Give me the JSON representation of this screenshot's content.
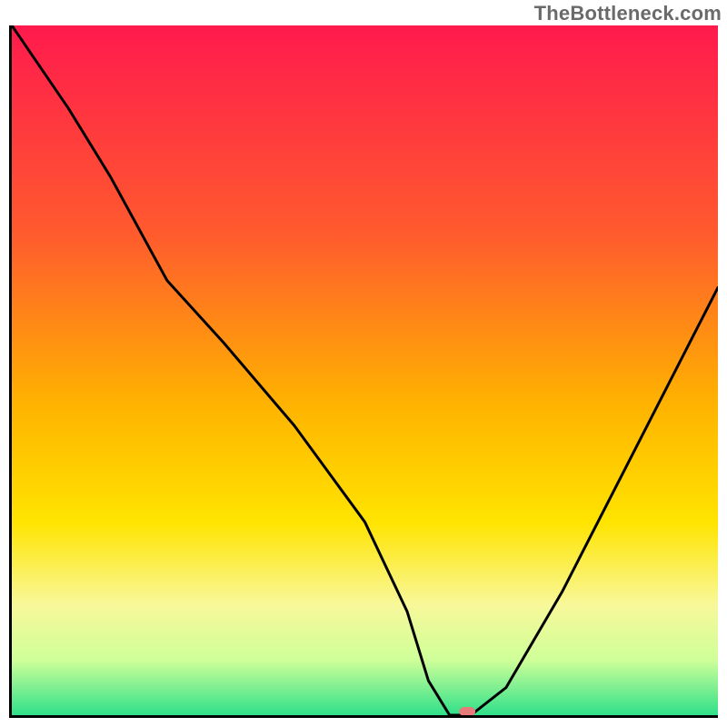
{
  "watermark": "TheBottleneck.com",
  "chart_data": {
    "type": "line",
    "title": "",
    "xlabel": "",
    "ylabel": "",
    "xlim": [
      0,
      100
    ],
    "ylim": [
      0,
      100
    ],
    "background_gradient_stops": [
      {
        "offset": 0,
        "color": "#ff1a4d"
      },
      {
        "offset": 30,
        "color": "#ff5a2e"
      },
      {
        "offset": 55,
        "color": "#ffb300"
      },
      {
        "offset": 72,
        "color": "#ffe400"
      },
      {
        "offset": 84,
        "color": "#f8f89a"
      },
      {
        "offset": 92,
        "color": "#cfff99"
      },
      {
        "offset": 100,
        "color": "#2fe08a"
      }
    ],
    "curve": {
      "x": [
        0,
        8,
        14,
        22,
        30,
        40,
        50,
        56,
        59,
        62,
        65,
        70,
        78,
        88,
        100
      ],
      "values": [
        100,
        88,
        78,
        63,
        54,
        42,
        28,
        15,
        5,
        0,
        0,
        4,
        18,
        38,
        62
      ]
    },
    "marker": {
      "x": 64.5,
      "y": 0,
      "color": "#e77b7b",
      "shape": "rounded-rect"
    }
  }
}
